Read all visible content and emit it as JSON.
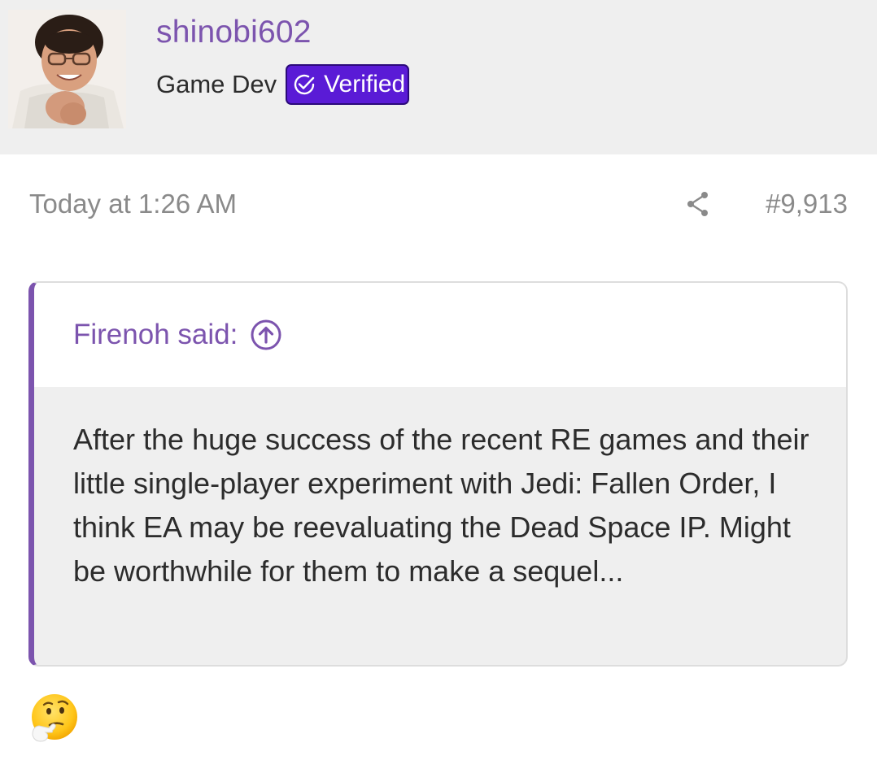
{
  "author": {
    "username": "shinobi602",
    "title": "Game Dev",
    "badge": "Verified",
    "avatar_icon": "user-avatar-photo"
  },
  "post": {
    "date": "Today at 1:26 AM",
    "number": "#9,913",
    "share_icon": "share-icon"
  },
  "quote": {
    "attribution": "Firenoh said:",
    "jump_icon": "arrow-up-circle-icon",
    "text": "After the huge success of the recent RE games and their little single-player experiment with Jedi: Fallen Order, I think EA may be reevaluating the Dead Space IP. Might be worthwhile for them to make a sequel..."
  },
  "reply": {
    "emoji": "thinking-face-emoji"
  },
  "colors": {
    "accent": "#7c54ae",
    "badge_bg": "#5a1bd6",
    "header_bg": "#efefef",
    "quote_bg": "#efefef",
    "text": "#2c2c2c",
    "muted": "#8a8a8a"
  }
}
